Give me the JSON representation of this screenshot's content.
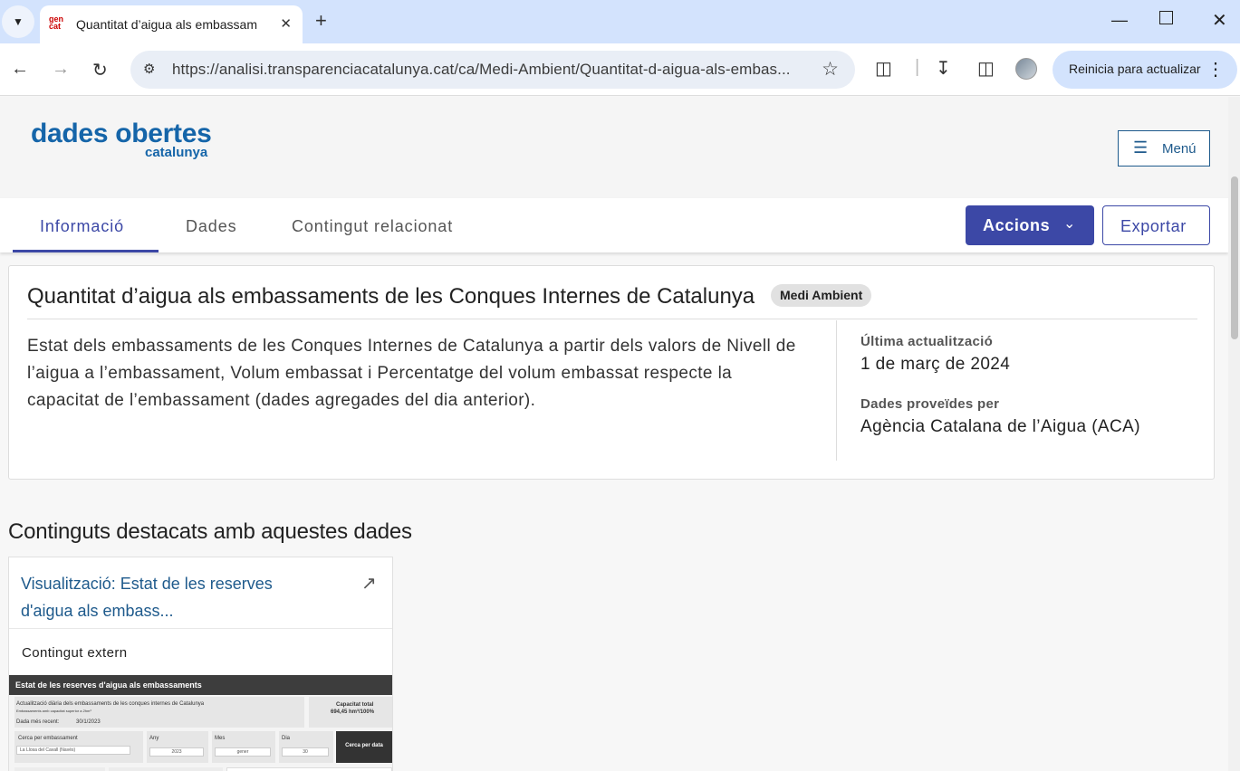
{
  "browser": {
    "tab_title": "Quantitat d’aigua als embassam",
    "favicon_text_top": "gen",
    "favicon_text_bottom": "cat",
    "url": "https://analisi.transparenciacatalunya.cat/ca/Medi-Ambient/Quantitat-d-aigua-als-embas...",
    "update_button": "Reinicia para actualizar",
    "icons": [
      "tab-search-icon",
      "close-icon",
      "new-tab-icon",
      "minimize-icon",
      "maximize-icon",
      "window-close-icon",
      "back-icon",
      "forward-icon",
      "reload-icon",
      "site-info-icon",
      "star-icon",
      "extensions-icon",
      "download-icon",
      "side-panel-icon",
      "kebab-menu-icon"
    ]
  },
  "header": {
    "logo_main": "dades obertes",
    "logo_sub": "catalunya",
    "menu_label": "Menú"
  },
  "tabs": [
    {
      "label": "Informació",
      "active": true
    },
    {
      "label": "Dades",
      "active": false
    },
    {
      "label": "Contingut relacionat",
      "active": false
    }
  ],
  "actions": {
    "accions_label": "Accions",
    "exportar_label": "Exportar"
  },
  "dataset": {
    "title": "Quantitat d’aigua als embassaments de les Conques Internes de Catalunya",
    "category": "Medi Ambient",
    "description": "Estat dels embassaments de les Conques Internes de Catalunya a partir dels valors de Nivell de l’aigua a l’embassament, Volum embassat i Percentatge del volum embassat respecte la capacitat de l’embassament (dades agregades del dia anterior).",
    "last_update_label": "Última actualització",
    "last_update_value": "1 de març de 2024",
    "provider_label": "Dades proveïdes per",
    "provider_value": "Agència Catalana de l’Aigua (ACA)"
  },
  "featured": {
    "section_title": "Continguts destacats amb aquestes dades",
    "card_title": "Visualització: Estat de les reserves d'aigua als embass...",
    "card_type": "Contingut extern",
    "thumbnail": {
      "header": "Estat de les reserves d'aigua als embassaments",
      "line1": "Actualització diària dels embassaments de les conques internes de Catalunya",
      "line2": "Embassaments amb capacitat superior a 2hm³",
      "recent_label": "Dada més recent:",
      "recent_value": "30/1/2023",
      "capacity_label": "Capacitat total",
      "capacity_value": "694,45 hm³/100%",
      "search_label": "Cerca per embassament",
      "search_value": "La Llosa del Cavall (Navès)",
      "year_label": "Any",
      "year_value": "2023",
      "month_label": "Mes",
      "month_value": "gener",
      "day_label": "Dia",
      "day_value": "30",
      "search_date_button": "Cerca per data"
    }
  }
}
